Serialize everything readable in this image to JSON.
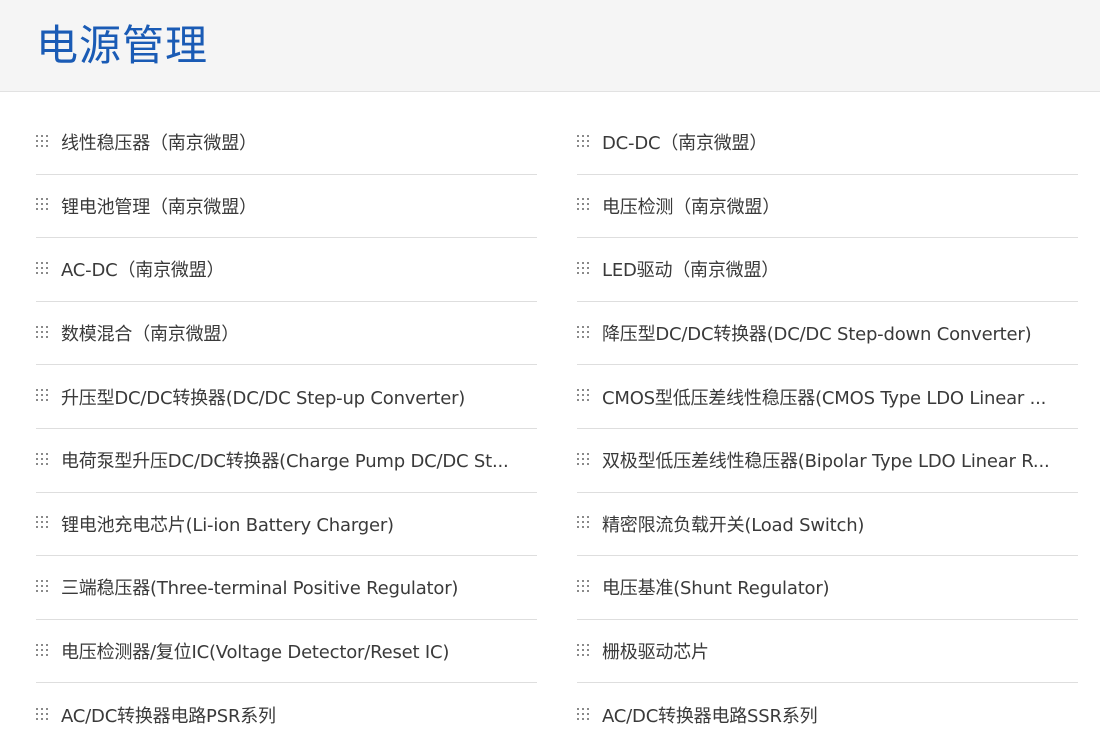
{
  "header": {
    "title": "电源管理"
  },
  "colors": {
    "title": "#1a5bb5",
    "header_bg": "#f5f5f5",
    "divider": "#dedede",
    "text": "#3a3a3a"
  },
  "icons": {
    "item_marker": "grip-dots-icon"
  },
  "categories": {
    "left": [
      "线性稳压器（南京微盟）",
      "锂电池管理（南京微盟）",
      "AC-DC（南京微盟）",
      "数模混合（南京微盟）",
      "升压型DC/DC转换器(DC/DC Step-up Converter)",
      "电荷泵型升压DC/DC转换器(Charge Pump DC/DC St...",
      "锂电池充电芯片(Li-ion Battery Charger)",
      "三端稳压器(Three-terminal Positive Regulator)",
      "电压检测器/复位IC(Voltage Detector/Reset IC)",
      "AC/DC转换器电路PSR系列"
    ],
    "right": [
      "DC-DC（南京微盟）",
      "电压检测（南京微盟）",
      "LED驱动（南京微盟）",
      "降压型DC/DC转换器(DC/DC Step-down Converter)",
      "CMOS型低压差线性稳压器(CMOS Type LDO Linear ...",
      "双极型低压差线性稳压器(Bipolar Type LDO Linear R...",
      "精密限流负载开关(Load Switch)",
      "电压基准(Shunt Regulator)",
      "栅极驱动芯片",
      "AC/DC转换器电路SSR系列"
    ]
  }
}
